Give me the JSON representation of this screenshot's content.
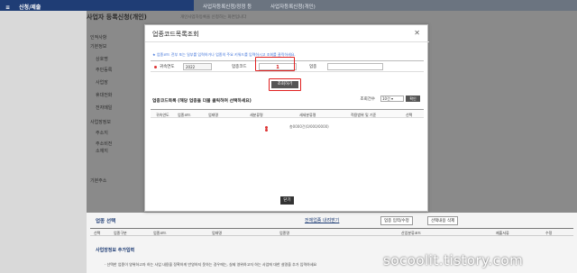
{
  "topbar": {
    "menu_label": "신청/제출",
    "crumb1": "사업자등록신청/정정 등",
    "crumb2": "사업자등록신청(개인)"
  },
  "page": {
    "title": "사업자 등록신청(개인)",
    "subtitle": "개인사업자등록을 신청하는 화면입니다",
    "left_labels": [
      "인적사항",
      "기본정보",
      "상호명",
      "주민등록",
      "사업장",
      "휴대전화",
      "전자메일",
      "사업장정보",
      "주소지",
      "주소비전",
      "소재지",
      "기본주소"
    ],
    "bottom": {
      "section1": "업종 선택",
      "link1": "전체업종 내려받기",
      "btn1": "업종 입력/수정",
      "btn2": "선택내용 삭제",
      "cols": [
        "선택",
        "업종구분",
        "업종코드",
        "업태명",
        "업종명",
        "산업분류코드",
        "제출서류",
        "수정"
      ],
      "section2": "사업장정보 추가입력",
      "note": "· 선택한 업종이 영위하고자 하는 사업 내용을 정확하게 반영하지 못하는 경우에는, 실제 영위하고자 하는 사업에 대한 설명을 추가 입력하세요"
    }
  },
  "modal": {
    "title": "업종코드목록조회",
    "notice": "★ 업종코드 전부 또는 일부를 입력하거나 업종의 주요 키워드를 입력하시고 조회를 클릭하세요.",
    "year_label": "귀속연도",
    "year_value": "2022",
    "code_label": "업종코드",
    "code_value": "1",
    "name_label": "업종",
    "name_value": "",
    "search_btn": "조회하기",
    "list_title": "업종코드목록 (해당 업종을 더블 클릭하여 선택하세요)",
    "count_label": "조회건수",
    "count_select": "10건",
    "confirm_btn": "확인",
    "cols": [
      "귀속연도",
      "업종코드",
      "업태명",
      "세분류명",
      "세세분류명",
      "적용범위 및 기준",
      "선택"
    ],
    "row_value": "총0000건(0/000/0000)",
    "close_btn": "닫기"
  },
  "watermark": "socoolit.tistory.com",
  "colors": {
    "nav": "#1f3d75",
    "highlight": "#e02020"
  }
}
